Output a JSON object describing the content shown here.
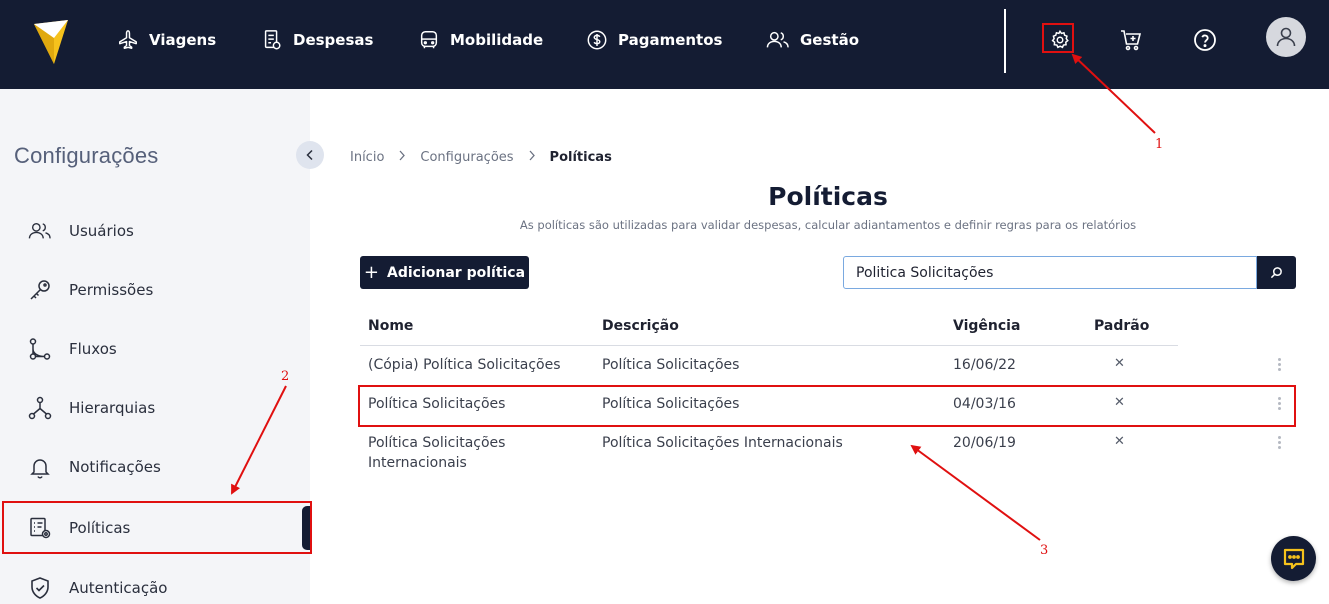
{
  "nav": {
    "items": [
      {
        "label": "Viagens",
        "icon": "airplane-icon"
      },
      {
        "label": "Despesas",
        "icon": "receipt-icon"
      },
      {
        "label": "Mobilidade",
        "icon": "car-icon"
      },
      {
        "label": "Pagamentos",
        "icon": "dollar-icon"
      },
      {
        "label": "Gestão",
        "icon": "users-icon"
      }
    ],
    "right_icons": [
      "gear-icon",
      "cart-plus-icon",
      "help-icon",
      "user-avatar-icon"
    ]
  },
  "sidebar": {
    "title": "Configurações",
    "items": [
      {
        "label": "Usuários",
        "icon": "users-icon"
      },
      {
        "label": "Permissões",
        "icon": "key-icon"
      },
      {
        "label": "Fluxos",
        "icon": "flow-icon"
      },
      {
        "label": "Hierarquias",
        "icon": "hierarchy-icon"
      },
      {
        "label": "Notificações",
        "icon": "bell-icon"
      },
      {
        "label": "Políticas",
        "icon": "policy-icon",
        "active": true
      },
      {
        "label": "Autenticação",
        "icon": "shield-icon"
      }
    ]
  },
  "breadcrumb": [
    "Início",
    "Configurações",
    "Políticas"
  ],
  "page": {
    "title": "Políticas",
    "subtitle": "As políticas são utilizadas para validar despesas, calcular adiantamentos e definir regras para os relatórios"
  },
  "toolbar": {
    "add_label": "Adicionar política",
    "search_value": "Politica Solicitações"
  },
  "table": {
    "headers": [
      "Nome",
      "Descrição",
      "Vigência",
      "Padrão"
    ],
    "rows": [
      {
        "name_line1": "(Cópia) Política Solicitações",
        "name_line2": "",
        "description": "Política Solicitações",
        "date": "16/06/22",
        "default": "✕"
      },
      {
        "name_line1": "Política Solicitações",
        "name_line2": "",
        "description": "Política Solicitações",
        "date": "04/03/16",
        "default": "✕"
      },
      {
        "name_line1": "Política Solicitações",
        "name_line2": "Internacionais",
        "description": "Política Solicitações Internacionais",
        "date": "20/06/19",
        "default": "✕"
      }
    ]
  },
  "annotations": [
    "1",
    "2",
    "3"
  ],
  "colors": {
    "navbar": "#141c33",
    "sidebar_bg": "#f4f5f8",
    "annotation": "#e01010",
    "search_border": "#7aa9e0"
  }
}
